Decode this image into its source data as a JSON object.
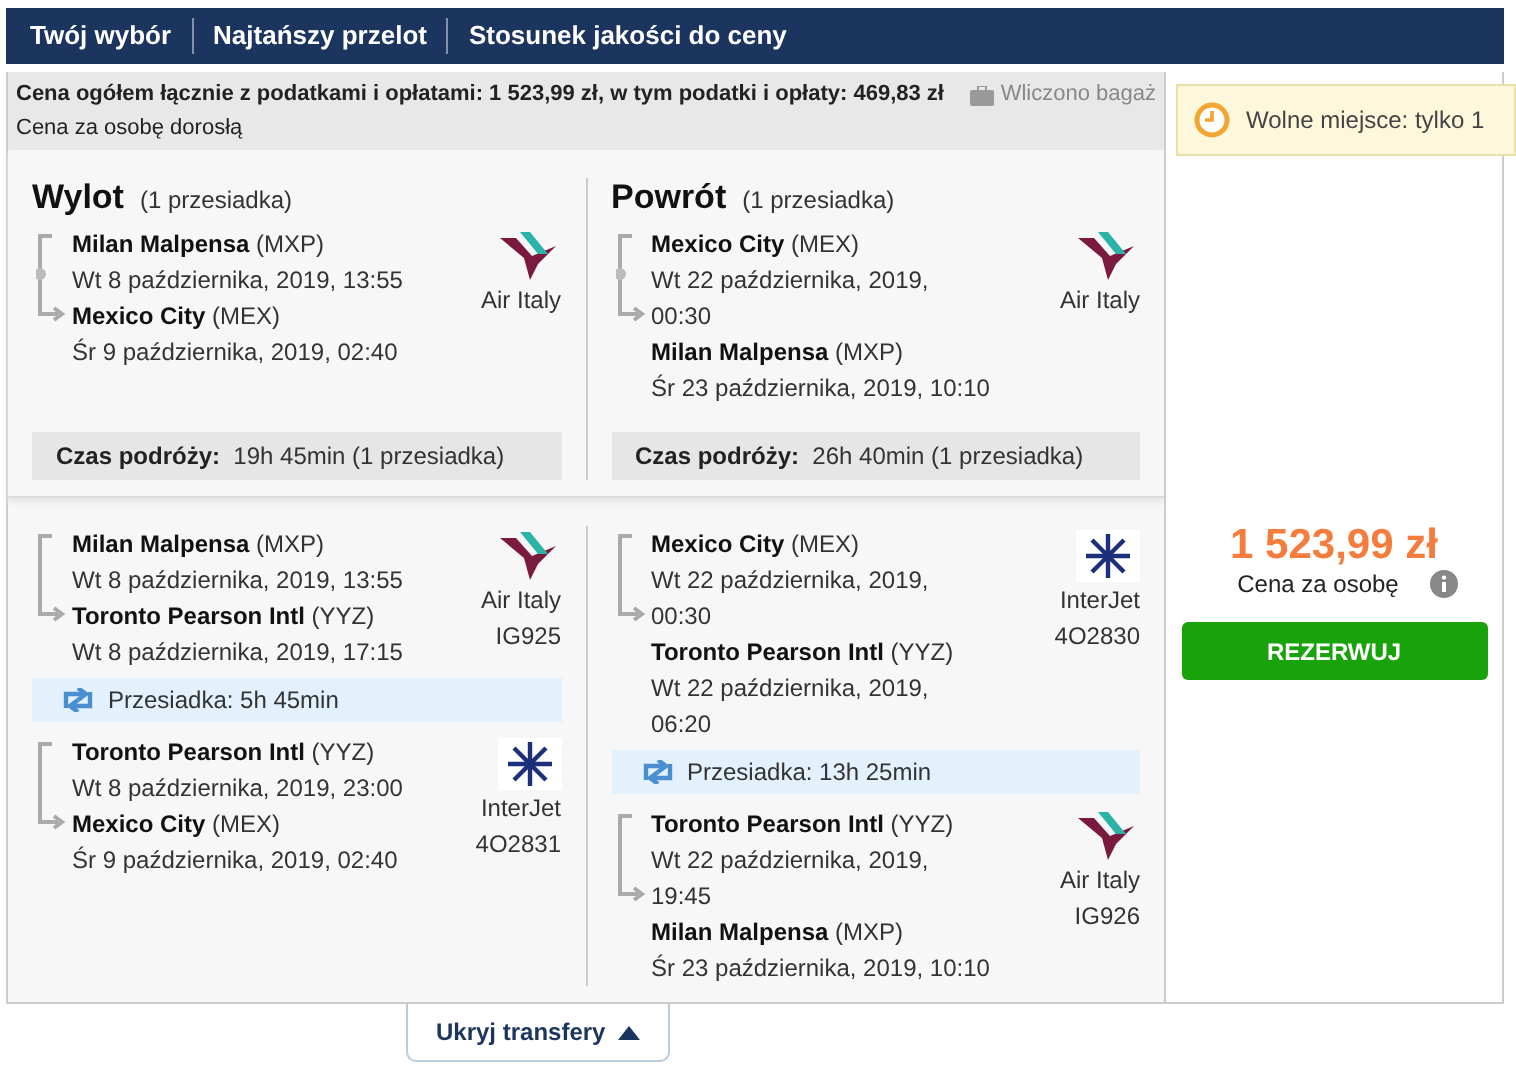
{
  "tabs": [
    {
      "label": "Twój wybór"
    },
    {
      "label": "Najtańszy przelot"
    },
    {
      "label": "Stosunek jakości do ceny"
    }
  ],
  "price_info": {
    "total": "Cena ogółem łącznie z podatkami i opłatami: 1 523,99 zł, w tym podatki i opłaty: 469,83 zł",
    "baggage": "Wliczono bagaż",
    "per_adult": "Cena za osobę dorosłą"
  },
  "summary": [
    {
      "title": "Wylot",
      "stops": "(1 przesiadka)",
      "from": "**Milan Malpensa** (MXP)",
      "from_time": [
        "Wt 8 października, 2019, 13:55"
      ],
      "to": "**Mexico City** (MEX)",
      "to_time": [
        "Śr 9 października, 2019, 02:40"
      ],
      "airline": "Air Italy",
      "logo": {
        "kind": "airitaly"
      },
      "duration_label": "Czas podróży:",
      "duration": "19h 45min (1 przesiadka)"
    },
    {
      "title": "Powrót",
      "stops": "(1 przesiadka)",
      "from": "**Mexico City** (MEX)",
      "from_time": [
        "Wt 22 października, 2019,",
        "00:30"
      ],
      "to": "**Milan Malpensa** (MXP)",
      "to_time": [
        "Śr 23 października, 2019, 10:10"
      ],
      "airline": "Air Italy",
      "logo": {
        "kind": "airitaly"
      },
      "duration_label": "Czas podróży:",
      "duration": "26h 40min (1 przesiadka)"
    }
  ],
  "details": [
    [
      {
        "kind": "flight",
        "from": "**Milan Malpensa** (MXP)",
        "from_time": [
          "Wt 8 października, 2019, 13:55"
        ],
        "to": "**Toronto Pearson Intl** (YYZ)",
        "to_time": [
          "Wt 8 października, 2019, 17:15"
        ],
        "airline": "Air Italy",
        "flight": "IG925",
        "logo": {
          "kind": "airitaly"
        }
      },
      {
        "kind": "layover",
        "text": "Przesiadka: 5h 45min"
      },
      {
        "kind": "flight",
        "from": "**Toronto Pearson Intl** (YYZ)",
        "from_time": [
          "Wt 8 października, 2019, 23:00"
        ],
        "to": "**Mexico City** (MEX)",
        "to_time": [
          "Śr 9 października, 2019, 02:40"
        ],
        "airline": "InterJet",
        "flight": "4O2831",
        "logo": {
          "kind": "interjet"
        }
      }
    ],
    [
      {
        "kind": "flight",
        "from": "**Mexico City** (MEX)",
        "from_time": [
          "Wt 22 października, 2019,",
          "00:30"
        ],
        "to": "**Toronto Pearson Intl** (YYZ)",
        "to_time": [
          "Wt 22 października, 2019,",
          "06:20"
        ],
        "airline": "InterJet",
        "flight": "4O2830",
        "logo": {
          "kind": "interjet"
        }
      },
      {
        "kind": "layover",
        "text": "Przesiadka: 13h 25min"
      },
      {
        "kind": "flight",
        "from": "**Toronto Pearson Intl** (YYZ)",
        "from_time": [
          "Wt 22 października, 2019,",
          "19:45"
        ],
        "to": "**Milan Malpensa** (MXP)",
        "to_time": [
          "Śr 23 października, 2019, 10:10"
        ],
        "airline": "Air Italy",
        "flight": "IG926",
        "logo": {
          "kind": "airitaly"
        }
      }
    ]
  ],
  "offer": {
    "alert": "Wolne miejsce: tylko 1",
    "price": "1 523,99 zł",
    "price_label": "Cena za osobę",
    "button": "REZERWUJ"
  },
  "toggle": "Ukryj transfery"
}
